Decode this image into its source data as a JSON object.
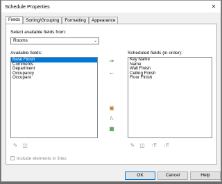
{
  "window": {
    "title": "Schedule Properties",
    "close_glyph": "✕"
  },
  "tabs": [
    {
      "label": "Fields",
      "active": true
    },
    {
      "label": "Sorting/Grouping",
      "active": false
    },
    {
      "label": "Formatting",
      "active": false
    },
    {
      "label": "Appearance",
      "active": false
    }
  ],
  "fields_tab": {
    "select_from_label": "Select available fields from:",
    "select_from_value": "Rooms",
    "available_label": "Available fields:",
    "available": [
      "Base Finish",
      "Comments",
      "Department",
      "Occupancy",
      "Occupant"
    ],
    "available_selected_index": 0,
    "scheduled_label": "Scheduled fields (in order):",
    "scheduled": [
      "Key Name",
      "Name",
      "Wall Finish",
      "Ceiling Finish",
      "Floor Finish"
    ],
    "include_links_label": "Include elements in links",
    "include_links_checked": false
  },
  "buttons": {
    "ok": "OK",
    "cancel": "Cancel",
    "help": "Help"
  },
  "accent_color": "#0078d7"
}
